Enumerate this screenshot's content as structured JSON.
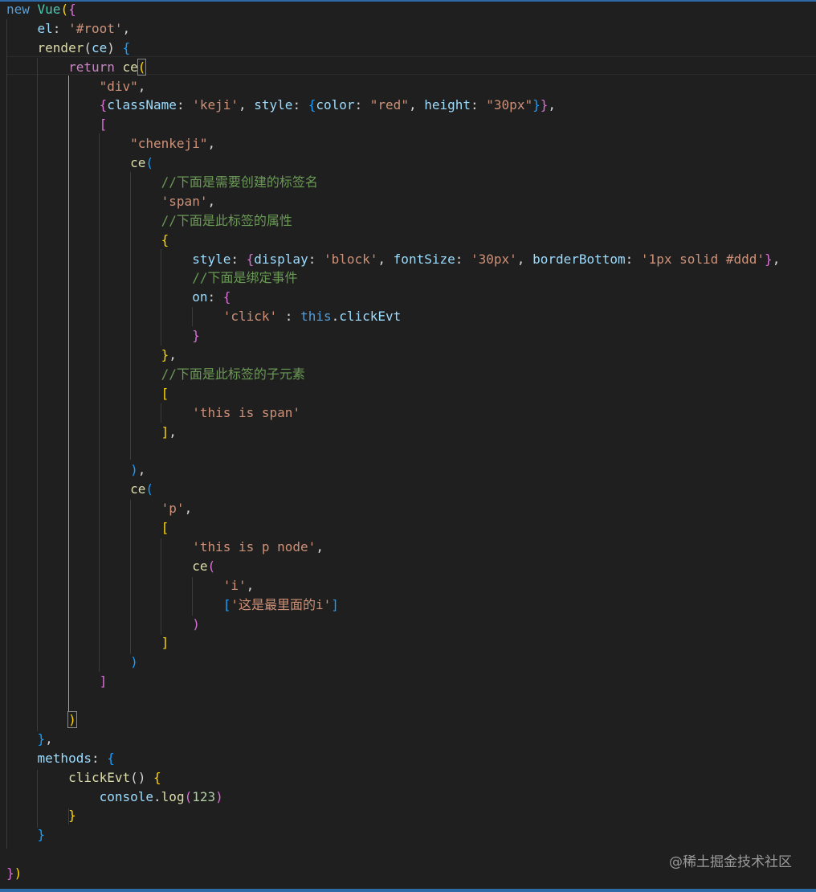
{
  "editor": {
    "language": "javascript",
    "lines": [
      [
        [
          "new ",
          "kw"
        ],
        [
          "Vue",
          "cls"
        ],
        [
          "(",
          "b1"
        ],
        [
          "{",
          "b2"
        ]
      ],
      [
        [
          "    "
        ],
        [
          "el",
          "prop"
        ],
        [
          ": "
        ],
        [
          "'#root'",
          "str"
        ],
        [
          ","
        ]
      ],
      [
        [
          "    "
        ],
        [
          "render",
          "fn"
        ],
        [
          "("
        ],
        [
          "ce",
          "prop"
        ],
        [
          ") "
        ],
        [
          "{",
          "b3"
        ]
      ],
      [
        [
          "        "
        ],
        [
          "return ",
          "ret"
        ],
        [
          "ce",
          "fn"
        ],
        [
          "(",
          "b1c"
        ]
      ],
      [
        [
          "            "
        ],
        [
          "\"div\"",
          "str"
        ],
        [
          ","
        ]
      ],
      [
        [
          "            "
        ],
        [
          "{",
          "b2"
        ],
        [
          "className",
          "prop"
        ],
        [
          ": "
        ],
        [
          "'keji'",
          "str"
        ],
        [
          ", "
        ],
        [
          "style",
          "prop"
        ],
        [
          ": "
        ],
        [
          "{",
          "b3"
        ],
        [
          "color",
          "prop"
        ],
        [
          ": "
        ],
        [
          "\"red\"",
          "str"
        ],
        [
          ", "
        ],
        [
          "height",
          "prop"
        ],
        [
          ": "
        ],
        [
          "\"30px\"",
          "str"
        ],
        [
          "}",
          "b3"
        ],
        [
          "}",
          "b2"
        ],
        [
          ","
        ]
      ],
      [
        [
          "            "
        ],
        [
          "[",
          "b2"
        ]
      ],
      [
        [
          "                "
        ],
        [
          "\"chenkeji\"",
          "str"
        ],
        [
          ","
        ]
      ],
      [
        [
          "                "
        ],
        [
          "ce",
          "fn"
        ],
        [
          "(",
          "b3"
        ]
      ],
      [
        [
          "                    "
        ],
        [
          "//下面是需要创建的标签名",
          "cm"
        ]
      ],
      [
        [
          "                    "
        ],
        [
          "'span'",
          "str"
        ],
        [
          ","
        ]
      ],
      [
        [
          "                    "
        ],
        [
          "//下面是此标签的属性",
          "cm"
        ]
      ],
      [
        [
          "                    "
        ],
        [
          "{",
          "b1"
        ]
      ],
      [
        [
          "                        "
        ],
        [
          "style",
          "prop"
        ],
        [
          ": "
        ],
        [
          "{",
          "b2"
        ],
        [
          "display",
          "prop"
        ],
        [
          ": "
        ],
        [
          "'block'",
          "str"
        ],
        [
          ", "
        ],
        [
          "fontSize",
          "prop"
        ],
        [
          ": "
        ],
        [
          "'30px'",
          "str"
        ],
        [
          ", "
        ],
        [
          "borderBottom",
          "prop"
        ],
        [
          ": "
        ],
        [
          "'1px solid #ddd'",
          "str"
        ],
        [
          "}",
          "b2"
        ],
        [
          ","
        ]
      ],
      [
        [
          "                        "
        ],
        [
          "//下面是绑定事件",
          "cm"
        ]
      ],
      [
        [
          "                        "
        ],
        [
          "on",
          "prop"
        ],
        [
          ": "
        ],
        [
          "{",
          "b2"
        ]
      ],
      [
        [
          "                            "
        ],
        [
          "'click'",
          "str"
        ],
        [
          " : "
        ],
        [
          "this",
          "kw"
        ],
        [
          "."
        ],
        [
          "clickEvt",
          "prop"
        ]
      ],
      [
        [
          "                        "
        ],
        [
          "}",
          "b2"
        ]
      ],
      [
        [
          "                    "
        ],
        [
          "}",
          "b1"
        ],
        [
          ","
        ]
      ],
      [
        [
          "                    "
        ],
        [
          "//下面是此标签的子元素",
          "cm"
        ]
      ],
      [
        [
          "                    "
        ],
        [
          "[",
          "b1"
        ]
      ],
      [
        [
          "                        "
        ],
        [
          "'this is span'",
          "str"
        ]
      ],
      [
        [
          "                    "
        ],
        [
          "]",
          "b1"
        ],
        [
          ","
        ]
      ],
      [
        [
          ""
        ]
      ],
      [
        [
          "                "
        ],
        [
          ")",
          "b3"
        ],
        [
          ","
        ]
      ],
      [
        [
          "                "
        ],
        [
          "ce",
          "fn"
        ],
        [
          "(",
          "b3"
        ]
      ],
      [
        [
          "                    "
        ],
        [
          "'p'",
          "str"
        ],
        [
          ","
        ]
      ],
      [
        [
          "                    "
        ],
        [
          "[",
          "b1"
        ]
      ],
      [
        [
          "                        "
        ],
        [
          "'this is p node'",
          "str"
        ],
        [
          ","
        ]
      ],
      [
        [
          "                        "
        ],
        [
          "ce",
          "fn"
        ],
        [
          "(",
          "b2"
        ]
      ],
      [
        [
          "                            "
        ],
        [
          "'i'",
          "str"
        ],
        [
          ","
        ]
      ],
      [
        [
          "                            "
        ],
        [
          "[",
          "b3"
        ],
        [
          "'这是最里面的i'",
          "str"
        ],
        [
          "]",
          "b3"
        ]
      ],
      [
        [
          "                        "
        ],
        [
          ")",
          "b2"
        ]
      ],
      [
        [
          "                    "
        ],
        [
          "]",
          "b1"
        ]
      ],
      [
        [
          "                "
        ],
        [
          ")",
          "b3"
        ]
      ],
      [
        [
          "            "
        ],
        [
          "]",
          "b2"
        ]
      ],
      [
        [
          ""
        ]
      ],
      [
        [
          "        "
        ],
        [
          ")",
          "b1c"
        ]
      ],
      [
        [
          "    "
        ],
        [
          "}",
          "b3"
        ],
        [
          ","
        ]
      ],
      [
        [
          "    "
        ],
        [
          "methods",
          "prop"
        ],
        [
          ": "
        ],
        [
          "{",
          "b3"
        ]
      ],
      [
        [
          "        "
        ],
        [
          "clickEvt",
          "fn"
        ],
        [
          "() "
        ],
        [
          "{",
          "b1"
        ]
      ],
      [
        [
          "            "
        ],
        [
          "console",
          "prop"
        ],
        [
          "."
        ],
        [
          "log",
          "fn"
        ],
        [
          "(",
          "b2"
        ],
        [
          "123",
          "num"
        ],
        [
          ")",
          "b2"
        ]
      ],
      [
        [
          "        "
        ],
        [
          "}",
          "b1"
        ]
      ],
      [
        [
          "    "
        ],
        [
          "}",
          "b3"
        ]
      ],
      [
        [
          ""
        ]
      ],
      [
        [
          "}",
          "b2"
        ],
        [
          ")",
          "b1"
        ]
      ]
    ]
  },
  "watermark": "@稀土掘金技术社区"
}
